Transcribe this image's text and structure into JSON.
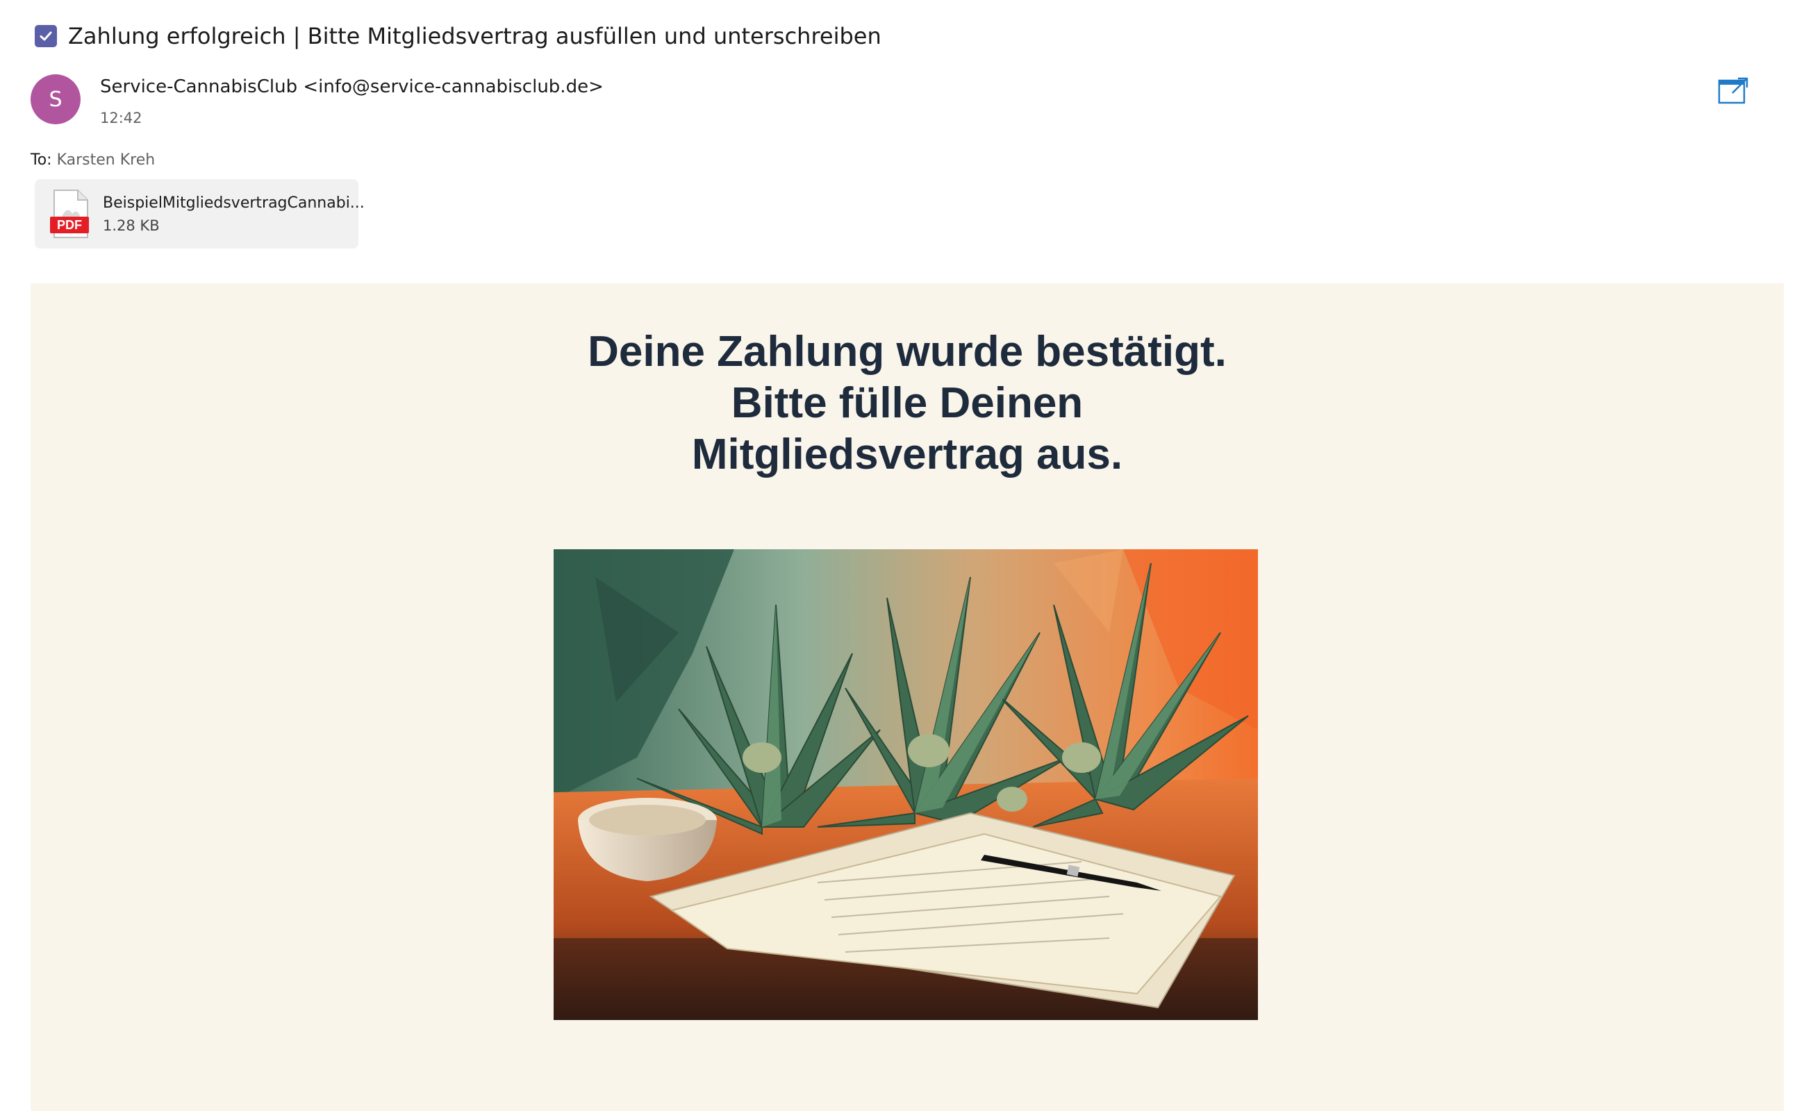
{
  "email": {
    "subject": "Zahlung erfolgreich  |  Bitte Mitgliedsvertrag ausfüllen und unterschreiben",
    "sender": {
      "initial": "S",
      "display": "Service-CannabisClub <info@service-cannabisclub.de>",
      "time": "12:42",
      "avatar_color": "#b1569e"
    },
    "to": {
      "label": "To:",
      "name": "Karsten Kreh"
    },
    "attachment": {
      "icon": "pdf-icon",
      "icon_label": "PDF",
      "name": "BeispielMitgliedsvertragCannabi...",
      "size": "1.28 KB"
    },
    "body": {
      "headline_lines": [
        "Deine Zahlung wurde bestätigt.",
        "Bitte fülle Deinen",
        "Mitgliedsvertrag aus."
      ],
      "background": "#faf5eb",
      "headline_color": "#1e2b3c"
    }
  },
  "colors": {
    "accent": "#5b5fa7",
    "popout": "#1f7ac7"
  }
}
